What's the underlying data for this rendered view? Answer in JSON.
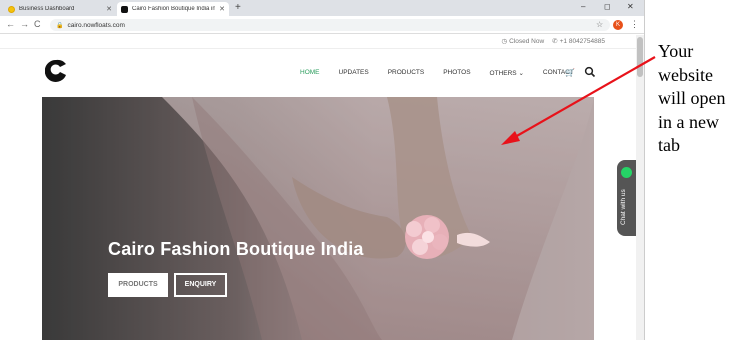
{
  "browser": {
    "tabs": [
      {
        "title": "Business Dashboard",
        "close": "✕"
      },
      {
        "title": "Cairo Fashion Boutique India in S",
        "close": "✕"
      }
    ],
    "new_tab": "+",
    "window_controls": {
      "minimize": "–",
      "maximize": "◻",
      "close": "✕"
    },
    "nav": {
      "back": "←",
      "forward": "→",
      "reload": "C"
    },
    "url": "cairo.nowfloats.com",
    "profile_initial": "K",
    "bookmark_icon": "star-icon",
    "menu_icon": "⋮"
  },
  "site": {
    "top_info": {
      "status": "Closed Now",
      "phone": "+1 8042754885"
    },
    "nav": [
      "HOME",
      "UPDATES",
      "PRODUCTS",
      "PHOTOS",
      "OTHERS ⌄",
      "CONTACT"
    ],
    "active_nav": "HOME",
    "hero": {
      "title": "Cairo Fashion Boutique India",
      "primary_button": "PRODUCTS",
      "secondary_button": "ENQUIRY"
    },
    "chat_label": "Chat with us"
  },
  "annotation": {
    "lines": [
      "Your",
      "website",
      "will open",
      "in a new",
      "tab"
    ],
    "arrow_color": "#e8121a"
  },
  "colors": {
    "active_nav": "#2a9d5c",
    "hero_overlay": "#3a3a3a",
    "whatsapp": "#25d366"
  }
}
